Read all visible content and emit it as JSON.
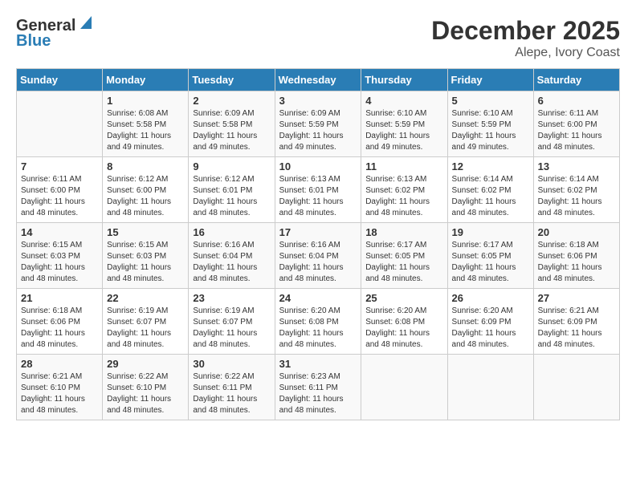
{
  "header": {
    "logo_general": "General",
    "logo_blue": "Blue",
    "title": "December 2025",
    "subtitle": "Alepe, Ivory Coast"
  },
  "weekdays": [
    "Sunday",
    "Monday",
    "Tuesday",
    "Wednesday",
    "Thursday",
    "Friday",
    "Saturday"
  ],
  "weeks": [
    [
      {
        "day": "",
        "sunrise": "",
        "sunset": "",
        "daylight": ""
      },
      {
        "day": "1",
        "sunrise": "Sunrise: 6:08 AM",
        "sunset": "Sunset: 5:58 PM",
        "daylight": "Daylight: 11 hours and 49 minutes."
      },
      {
        "day": "2",
        "sunrise": "Sunrise: 6:09 AM",
        "sunset": "Sunset: 5:58 PM",
        "daylight": "Daylight: 11 hours and 49 minutes."
      },
      {
        "day": "3",
        "sunrise": "Sunrise: 6:09 AM",
        "sunset": "Sunset: 5:59 PM",
        "daylight": "Daylight: 11 hours and 49 minutes."
      },
      {
        "day": "4",
        "sunrise": "Sunrise: 6:10 AM",
        "sunset": "Sunset: 5:59 PM",
        "daylight": "Daylight: 11 hours and 49 minutes."
      },
      {
        "day": "5",
        "sunrise": "Sunrise: 6:10 AM",
        "sunset": "Sunset: 5:59 PM",
        "daylight": "Daylight: 11 hours and 49 minutes."
      },
      {
        "day": "6",
        "sunrise": "Sunrise: 6:11 AM",
        "sunset": "Sunset: 6:00 PM",
        "daylight": "Daylight: 11 hours and 48 minutes."
      }
    ],
    [
      {
        "day": "7",
        "sunrise": "Sunrise: 6:11 AM",
        "sunset": "Sunset: 6:00 PM",
        "daylight": "Daylight: 11 hours and 48 minutes."
      },
      {
        "day": "8",
        "sunrise": "Sunrise: 6:12 AM",
        "sunset": "Sunset: 6:00 PM",
        "daylight": "Daylight: 11 hours and 48 minutes."
      },
      {
        "day": "9",
        "sunrise": "Sunrise: 6:12 AM",
        "sunset": "Sunset: 6:01 PM",
        "daylight": "Daylight: 11 hours and 48 minutes."
      },
      {
        "day": "10",
        "sunrise": "Sunrise: 6:13 AM",
        "sunset": "Sunset: 6:01 PM",
        "daylight": "Daylight: 11 hours and 48 minutes."
      },
      {
        "day": "11",
        "sunrise": "Sunrise: 6:13 AM",
        "sunset": "Sunset: 6:02 PM",
        "daylight": "Daylight: 11 hours and 48 minutes."
      },
      {
        "day": "12",
        "sunrise": "Sunrise: 6:14 AM",
        "sunset": "Sunset: 6:02 PM",
        "daylight": "Daylight: 11 hours and 48 minutes."
      },
      {
        "day": "13",
        "sunrise": "Sunrise: 6:14 AM",
        "sunset": "Sunset: 6:02 PM",
        "daylight": "Daylight: 11 hours and 48 minutes."
      }
    ],
    [
      {
        "day": "14",
        "sunrise": "Sunrise: 6:15 AM",
        "sunset": "Sunset: 6:03 PM",
        "daylight": "Daylight: 11 hours and 48 minutes."
      },
      {
        "day": "15",
        "sunrise": "Sunrise: 6:15 AM",
        "sunset": "Sunset: 6:03 PM",
        "daylight": "Daylight: 11 hours and 48 minutes."
      },
      {
        "day": "16",
        "sunrise": "Sunrise: 6:16 AM",
        "sunset": "Sunset: 6:04 PM",
        "daylight": "Daylight: 11 hours and 48 minutes."
      },
      {
        "day": "17",
        "sunrise": "Sunrise: 6:16 AM",
        "sunset": "Sunset: 6:04 PM",
        "daylight": "Daylight: 11 hours and 48 minutes."
      },
      {
        "day": "18",
        "sunrise": "Sunrise: 6:17 AM",
        "sunset": "Sunset: 6:05 PM",
        "daylight": "Daylight: 11 hours and 48 minutes."
      },
      {
        "day": "19",
        "sunrise": "Sunrise: 6:17 AM",
        "sunset": "Sunset: 6:05 PM",
        "daylight": "Daylight: 11 hours and 48 minutes."
      },
      {
        "day": "20",
        "sunrise": "Sunrise: 6:18 AM",
        "sunset": "Sunset: 6:06 PM",
        "daylight": "Daylight: 11 hours and 48 minutes."
      }
    ],
    [
      {
        "day": "21",
        "sunrise": "Sunrise: 6:18 AM",
        "sunset": "Sunset: 6:06 PM",
        "daylight": "Daylight: 11 hours and 48 minutes."
      },
      {
        "day": "22",
        "sunrise": "Sunrise: 6:19 AM",
        "sunset": "Sunset: 6:07 PM",
        "daylight": "Daylight: 11 hours and 48 minutes."
      },
      {
        "day": "23",
        "sunrise": "Sunrise: 6:19 AM",
        "sunset": "Sunset: 6:07 PM",
        "daylight": "Daylight: 11 hours and 48 minutes."
      },
      {
        "day": "24",
        "sunrise": "Sunrise: 6:20 AM",
        "sunset": "Sunset: 6:08 PM",
        "daylight": "Daylight: 11 hours and 48 minutes."
      },
      {
        "day": "25",
        "sunrise": "Sunrise: 6:20 AM",
        "sunset": "Sunset: 6:08 PM",
        "daylight": "Daylight: 11 hours and 48 minutes."
      },
      {
        "day": "26",
        "sunrise": "Sunrise: 6:20 AM",
        "sunset": "Sunset: 6:09 PM",
        "daylight": "Daylight: 11 hours and 48 minutes."
      },
      {
        "day": "27",
        "sunrise": "Sunrise: 6:21 AM",
        "sunset": "Sunset: 6:09 PM",
        "daylight": "Daylight: 11 hours and 48 minutes."
      }
    ],
    [
      {
        "day": "28",
        "sunrise": "Sunrise: 6:21 AM",
        "sunset": "Sunset: 6:10 PM",
        "daylight": "Daylight: 11 hours and 48 minutes."
      },
      {
        "day": "29",
        "sunrise": "Sunrise: 6:22 AM",
        "sunset": "Sunset: 6:10 PM",
        "daylight": "Daylight: 11 hours and 48 minutes."
      },
      {
        "day": "30",
        "sunrise": "Sunrise: 6:22 AM",
        "sunset": "Sunset: 6:11 PM",
        "daylight": "Daylight: 11 hours and 48 minutes."
      },
      {
        "day": "31",
        "sunrise": "Sunrise: 6:23 AM",
        "sunset": "Sunset: 6:11 PM",
        "daylight": "Daylight: 11 hours and 48 minutes."
      },
      {
        "day": "",
        "sunrise": "",
        "sunset": "",
        "daylight": ""
      },
      {
        "day": "",
        "sunrise": "",
        "sunset": "",
        "daylight": ""
      },
      {
        "day": "",
        "sunrise": "",
        "sunset": "",
        "daylight": ""
      }
    ]
  ]
}
